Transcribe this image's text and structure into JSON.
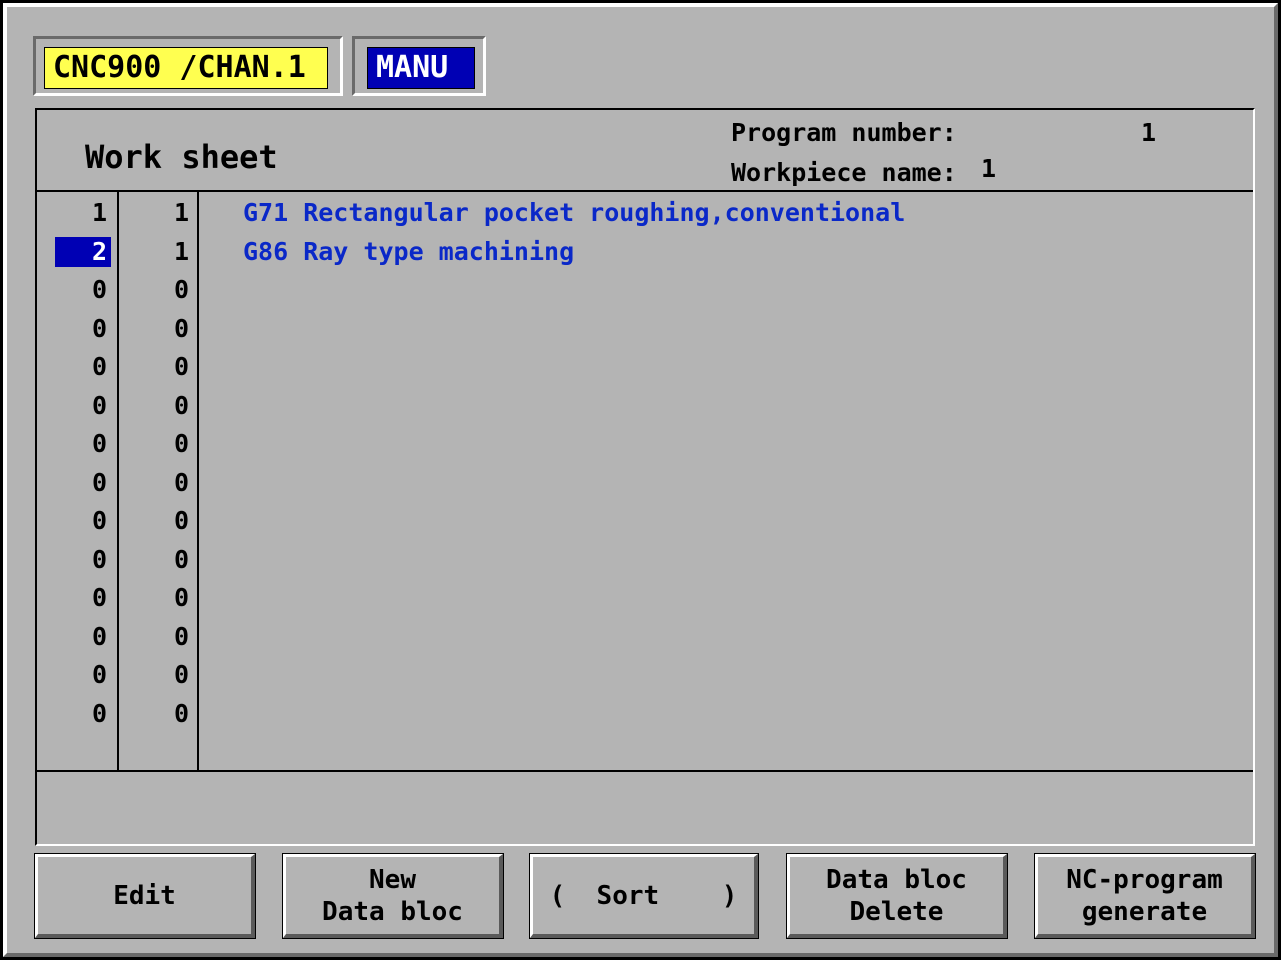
{
  "header": {
    "channel_label": "CNC900 /CHAN.1",
    "mode_label": "MANU"
  },
  "worksheet": {
    "title": "Work sheet",
    "program_number_label": "Program number:",
    "program_number_value": "1",
    "workpiece_name_label": "Workpiece name:",
    "workpiece_name_value": "1"
  },
  "rows": [
    {
      "num": "1",
      "count": "1",
      "desc": "G71 Rectangular pocket roughing,conventional",
      "selected": false
    },
    {
      "num": "2",
      "count": "1",
      "desc": "G86 Ray type machining",
      "selected": true
    },
    {
      "num": "0",
      "count": "0",
      "desc": ""
    },
    {
      "num": "0",
      "count": "0",
      "desc": ""
    },
    {
      "num": "0",
      "count": "0",
      "desc": ""
    },
    {
      "num": "0",
      "count": "0",
      "desc": ""
    },
    {
      "num": "0",
      "count": "0",
      "desc": ""
    },
    {
      "num": "0",
      "count": "0",
      "desc": ""
    },
    {
      "num": "0",
      "count": "0",
      "desc": ""
    },
    {
      "num": "0",
      "count": "0",
      "desc": ""
    },
    {
      "num": "0",
      "count": "0",
      "desc": ""
    },
    {
      "num": "0",
      "count": "0",
      "desc": ""
    },
    {
      "num": "0",
      "count": "0",
      "desc": ""
    },
    {
      "num": "0",
      "count": "0",
      "desc": ""
    }
  ],
  "softkeys": {
    "edit": {
      "line1": "Edit"
    },
    "new_data_bloc": {
      "line1": "New",
      "line2": "Data bloc"
    },
    "sort": {
      "line1": "(  Sort    )"
    },
    "delete_data_bloc": {
      "line1": "Data bloc",
      "line2": "Delete"
    },
    "nc_generate": {
      "line1": "NC-program",
      "line2": "generate"
    }
  },
  "colors": {
    "background": "#b4b4b4",
    "channel_bg": "#ffff50",
    "mode_bg": "#0000b4",
    "selection_bg": "#0000b4",
    "description_text": "#0a28c8"
  }
}
